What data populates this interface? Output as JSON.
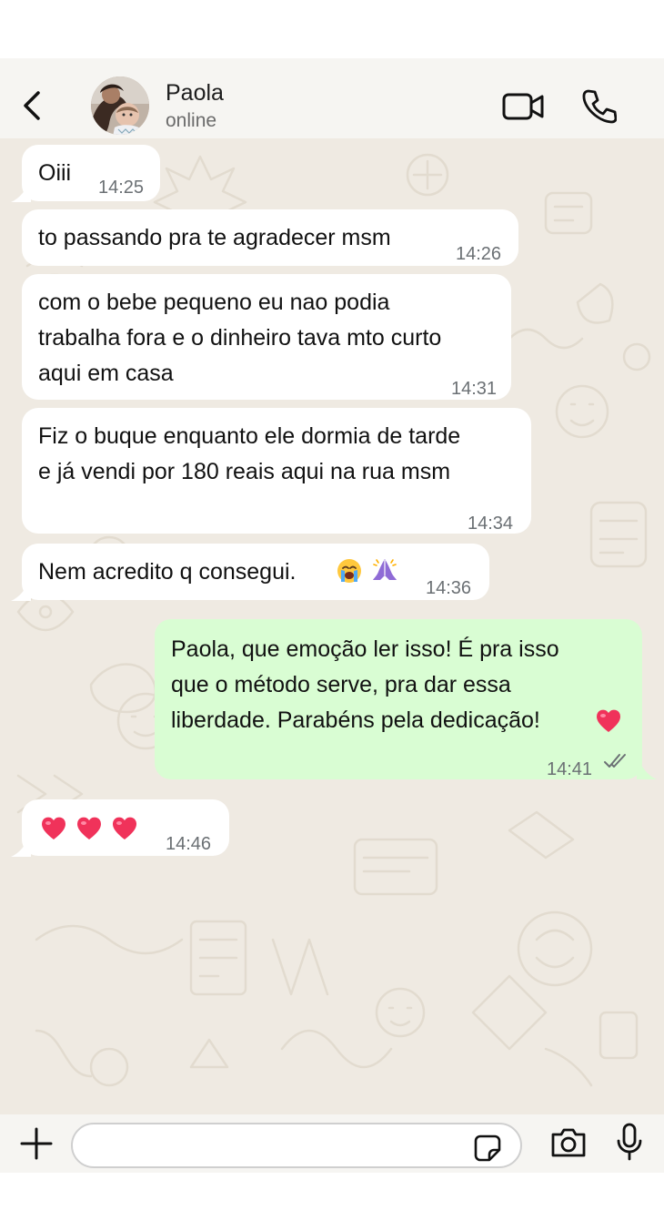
{
  "header": {
    "contact_name": "Paola",
    "contact_status": "online"
  },
  "messages": [
    {
      "direction": "in",
      "text": "Oiii",
      "time": "14:25"
    },
    {
      "direction": "in",
      "text": "to passando pra te agradecer msm",
      "time": "14:26"
    },
    {
      "direction": "in",
      "lines": [
        "com o bebe pequeno eu nao podia",
        "trabalha fora e o dinheiro tava mto curto",
        "aqui em casa"
      ],
      "time": "14:31"
    },
    {
      "direction": "in",
      "lines": [
        "Fiz o buque enquanto ele dormia de tarde",
        "e já vendi por 180 reais aqui na rua msm"
      ],
      "time": "14:34"
    },
    {
      "direction": "in",
      "text": "Nem acredito q consegui.",
      "emojis": [
        "loudly-crying-face",
        "folded-hands"
      ],
      "time": "14:36"
    },
    {
      "direction": "out",
      "lines": [
        "Paola, que emoção ler isso! É pra isso",
        "que o método serve, pra dar essa",
        "liberdade. Parabéns pela dedicação!"
      ],
      "emojis": [
        "red-heart"
      ],
      "time": "14:41",
      "status": "read"
    },
    {
      "direction": "in",
      "emojis": [
        "red-heart",
        "red-heart",
        "red-heart"
      ],
      "time": "14:46"
    }
  ],
  "composer": {
    "placeholder": ""
  },
  "colors": {
    "wallpaper": "#efeae2",
    "incoming": "#ffffff",
    "outgoing": "#d9fdd3",
    "heart": "#f0325a"
  }
}
